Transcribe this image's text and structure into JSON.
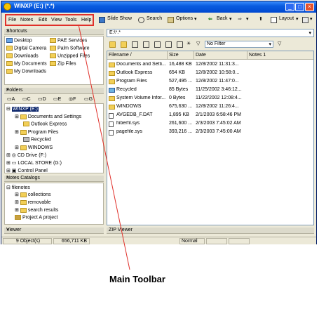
{
  "window": {
    "title": "WINXP (E:) (*.*)"
  },
  "menu": [
    "File",
    "Notes",
    "Edit",
    "View",
    "Tools",
    "Help"
  ],
  "toolbar": {
    "slideshow": "Slide Show",
    "search": "Search",
    "options": "Options",
    "back": "Back",
    "layout": "Layout"
  },
  "shortcuts": {
    "title": "Shortcuts",
    "left": [
      "Desktop",
      "Digital Camera",
      "Downloads",
      "My Documents",
      "My Downloads"
    ],
    "right": [
      "PAE Services",
      "Palm Software",
      "Unzipped Files",
      "Zip Files"
    ]
  },
  "folders": {
    "title": "Folders",
    "drives": [
      "A",
      "C",
      "D",
      "E",
      "F",
      "G"
    ],
    "tree": [
      "WINXP (E:)",
      "Documents and Settings",
      "Outlook Express",
      "Program Files",
      "Recycled",
      "WINDOWS",
      "CD Drive (F:)",
      "LOCAL STORE (G:)",
      "Control Panel"
    ]
  },
  "catalogs": {
    "title": "Notes Catalogs",
    "items": [
      "filenotes",
      "collections",
      "removable",
      "search results",
      "Project A project"
    ]
  },
  "viewer": {
    "title": "Viewer"
  },
  "zipviewer": {
    "title": "ZIP Viewer"
  },
  "path": {
    "value": "E:\\*.*"
  },
  "filter": {
    "label": "No Filter"
  },
  "columns": [
    "Filename",
    "Size",
    "Date",
    "Notes 1"
  ],
  "files": [
    {
      "name": "Documents and Setti...",
      "size": "16,488 KB",
      "date": "12/8/2002 11:31:3...",
      "kind": "folder"
    },
    {
      "name": "Outlook Express",
      "size": "654 KB",
      "date": "12/8/2002 10:58:0...",
      "kind": "folder"
    },
    {
      "name": "Program Files",
      "size": "527,495 ...",
      "date": "12/8/2002 11:47:0...",
      "kind": "folder"
    },
    {
      "name": "Recycled",
      "size": "85 Bytes",
      "date": "11/25/2002 3:46:12...",
      "kind": "recycle"
    },
    {
      "name": "System Volume Infor...",
      "size": "0 Bytes",
      "date": "11/22/2002 12:08:4...",
      "kind": "folder"
    },
    {
      "name": "WINDOWS",
      "size": "675,630 ...",
      "date": "12/8/2002 11:26:4...",
      "kind": "folder"
    },
    {
      "name": "AVGEDB_F.DAT",
      "size": "1,895 KB",
      "date": "2/1/2003 6:58:46 PM",
      "kind": "file"
    },
    {
      "name": "hiberfil.sys",
      "size": "261,600 ...",
      "date": "2/3/2003 7:45:02 AM",
      "kind": "file"
    },
    {
      "name": "pagefile.sys",
      "size": "393,216 ...",
      "date": "2/3/2003 7:45:00 AM",
      "kind": "file"
    }
  ],
  "status": {
    "objects": "9 Object(s)",
    "size": "656,711 KB",
    "mode": "Normal"
  },
  "caption": {
    "text": "Main Toolbar"
  },
  "colors": {
    "highlight": "#e0302a",
    "titlebar": "#0a5ce0"
  }
}
